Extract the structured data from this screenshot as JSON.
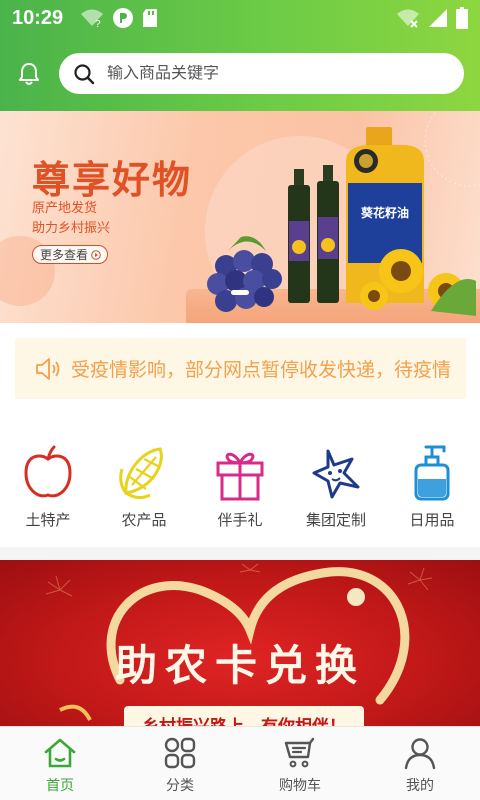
{
  "status_bar": {
    "time": "10:29"
  },
  "search": {
    "placeholder": "输入商品关键字"
  },
  "banner": {
    "title": "尊享好物",
    "line1": "原产地发货",
    "line2": "助力乡村振兴",
    "more_label": "更多查看",
    "bottle_label": "葵花籽油"
  },
  "notice": {
    "text": "受疫情影响，部分网点暂停收发快递，待疫情"
  },
  "categories": [
    {
      "label": "土特产",
      "icon": "apple-icon"
    },
    {
      "label": "农产品",
      "icon": "corn-icon"
    },
    {
      "label": "伴手礼",
      "icon": "gift-icon"
    },
    {
      "label": "集团定制",
      "icon": "star-icon"
    },
    {
      "label": "日用品",
      "icon": "pump-bottle-icon"
    }
  ],
  "promo": {
    "title": "助农卡兑换",
    "subtitle": "乡村振兴路上，有你相伴！"
  },
  "tabbar": [
    {
      "label": "首页",
      "icon": "home-icon",
      "active": true
    },
    {
      "label": "分类",
      "icon": "grid-icon",
      "active": false
    },
    {
      "label": "购物车",
      "icon": "cart-icon",
      "active": false
    },
    {
      "label": "我的",
      "icon": "user-icon",
      "active": false
    }
  ],
  "colors": {
    "header_green": "#4ab34a",
    "accent_orange": "#e05225",
    "notice_text": "#f2a04a",
    "promo_red": "#c11818",
    "tab_active": "#3aa83a"
  }
}
